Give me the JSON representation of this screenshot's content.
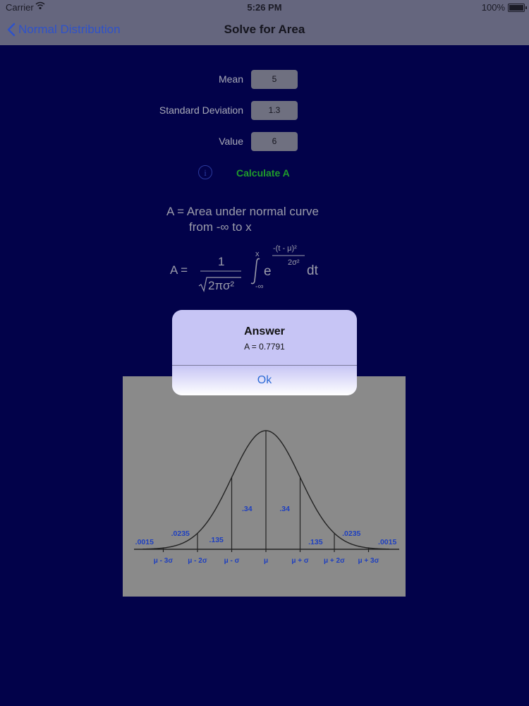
{
  "status_bar": {
    "carrier": "Carrier",
    "time": "5:26 PM",
    "battery": "100%"
  },
  "nav": {
    "back_label": "Normal Distribution",
    "title": "Solve for Area"
  },
  "form": {
    "mean_label": "Mean",
    "mean_value": "5",
    "sd_label": "Standard Deviation",
    "sd_value": "1.3",
    "value_label": "Value",
    "value_value": "6",
    "info_glyph": "i",
    "calculate_label": "Calculate A"
  },
  "formula": {
    "line1": "A = Area under normal curve",
    "line2": "from -∞ to x",
    "lhs": "A =",
    "numerator": "1",
    "denominator": "2πσ²",
    "upper_limit": "x",
    "lower_limit": "-∞",
    "base": "e",
    "exp_numerator": "-(t - μ)²",
    "exp_denominator": "2σ²",
    "dt": "dt"
  },
  "chart_data": {
    "type": "area",
    "title": "",
    "regions": [
      ".0015",
      ".0235",
      ".135",
      ".34",
      ".34",
      ".135",
      ".0235",
      ".0015"
    ],
    "tick_labels": [
      "μ - 3σ",
      "μ - 2σ",
      "μ - σ",
      "μ",
      "μ + σ",
      "μ + 2σ",
      "μ + 3σ"
    ],
    "region_label_color": "#1e3fbf"
  },
  "alert": {
    "title": "Answer",
    "message": "A = 0.7791",
    "button": "Ok"
  },
  "colors": {
    "background": "#02024a",
    "accent": "#2d6bd6",
    "calculate": "#1f9c2b"
  }
}
